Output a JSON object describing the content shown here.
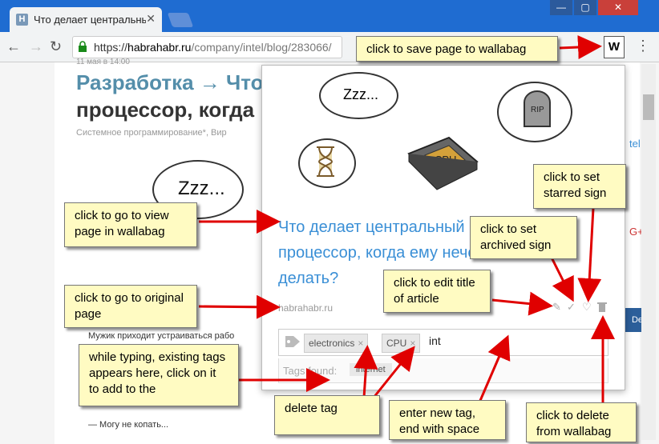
{
  "browser": {
    "tab_title": "Что делает центральны",
    "tab_favicon": "H",
    "url_host": "habrahabr.ru",
    "url_prefix": "https://",
    "url_path": "/company/intel/blog/283066/",
    "ext_icon": "W",
    "window_buttons": [
      "—",
      "▢",
      "✕"
    ]
  },
  "page": {
    "date": "11 мая в 14:00",
    "title_part1": "Разработка → Что",
    "title_part2": "процессор, когда",
    "hubs": "Системное программирование*, Вир",
    "text1": "Мужик приходит устраиваться рабо",
    "text2": "— Могу не копать...",
    "side1": "tel",
    "side2": "G+",
    "side3": "De"
  },
  "popup": {
    "zzz_small": "Zzz...",
    "zzz_big": "Zzz...",
    "title": "Что делает центральный процессор, когда ему нечего делать?",
    "domain": "habrahabr.ru",
    "tags": [
      "electronics",
      "CPU"
    ],
    "tag_input": "int",
    "tags_found_label": "Tags found:",
    "tag_suggestion": "internet"
  },
  "callouts": {
    "save": "click to save page to wallabag",
    "starred": "click to set starred sign",
    "archived": "click to set archived sign",
    "view": "click to go to view page in wallabag",
    "original": "click to go to original page",
    "edit": "click to edit title of article",
    "typing": "while typing, existing tags appears here, click on it to add to the",
    "delete_tag": "delete tag",
    "new_tag": "enter new tag, end with space",
    "delete": "click to delete from wallabag"
  },
  "colors": {
    "titlebar": "#1f6cd1",
    "callout_bg": "#fffbc2",
    "arrow": "#e00000",
    "link": "#3a8fd6"
  }
}
